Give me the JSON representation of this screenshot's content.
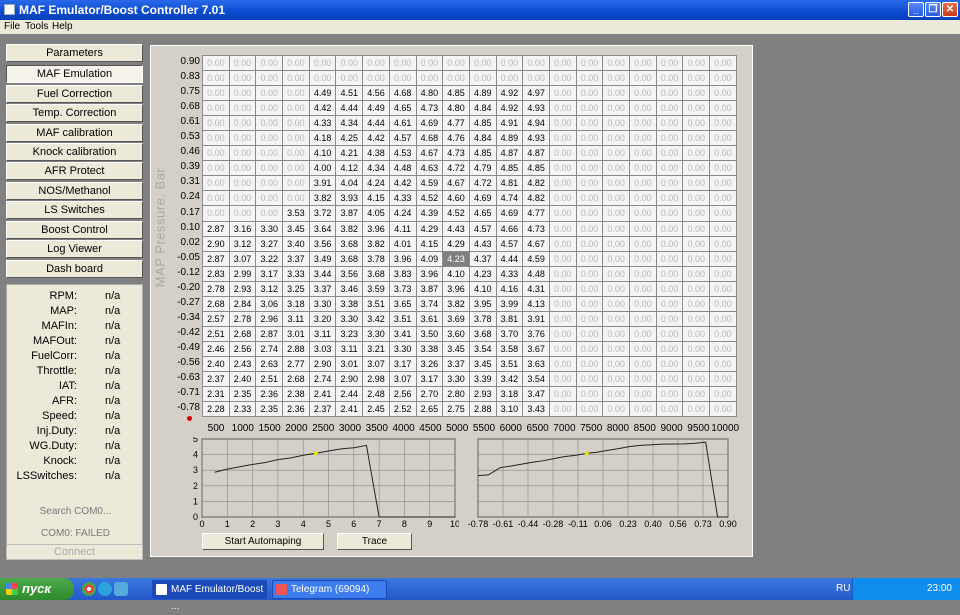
{
  "window": {
    "title": "MAF Emulator/Boost Controller 7.01"
  },
  "menu": [
    "File",
    "Tools",
    "Help"
  ],
  "nav": [
    "Parameters",
    "MAF Emulation",
    "Fuel Correction",
    "Temp. Correction",
    "MAF calibration",
    "Knock calibration",
    "AFR Protect",
    "NOS/Methanol",
    "LS Switches",
    "Boost Control",
    "Log Viewer",
    "Dash board"
  ],
  "status": {
    "rows": [
      [
        "RPM:",
        "n/a"
      ],
      [
        "MAP:",
        "n/a"
      ],
      [
        "MAFIn:",
        "n/a"
      ],
      [
        "MAFOut:",
        "n/a"
      ],
      [
        "FuelCorr:",
        "n/a"
      ],
      [
        "Throttle:",
        "n/a"
      ],
      [
        "IAT:",
        "n/a"
      ],
      [
        "AFR:",
        "n/a"
      ],
      [
        "Speed:",
        "n/a"
      ],
      [
        "Inj.Duty:",
        "n/a"
      ],
      [
        "WG.Duty:",
        "n/a"
      ],
      [
        "Knock:",
        "n/a"
      ],
      [
        "LSSwitches:",
        "n/a"
      ]
    ],
    "search": "Search COM0...",
    "com": "COM0: FAILED",
    "connect": "Connect"
  },
  "table": {
    "y_axis_label": "MAP Pressure, Bar",
    "rows": [
      "0.90",
      "0.83",
      "0.75",
      "0.68",
      "0.61",
      "0.53",
      "0.46",
      "0.39",
      "0.31",
      "0.24",
      "0.17",
      "0.10",
      "0.02",
      "-0.05",
      "-0.12",
      "-0.20",
      "-0.27",
      "-0.34",
      "-0.42",
      "-0.49",
      "-0.56",
      "-0.63",
      "-0.71",
      "-0.78"
    ],
    "cols": [
      "500",
      "1000",
      "1500",
      "2000",
      "2500",
      "3000",
      "3500",
      "4000",
      "4500",
      "5000",
      "5500",
      "6000",
      "6500",
      "7000",
      "7500",
      "8000",
      "8500",
      "9000",
      "9500",
      "10000"
    ],
    "selected": {
      "row": 13,
      "col": 9
    },
    "values": [
      [
        "0.00",
        "0.00",
        "0.00",
        "0.00",
        "0.00",
        "0.00",
        "0.00",
        "0.00",
        "0.00",
        "0.00",
        "0.00",
        "0.00",
        "0.00",
        "0.00",
        "0.00",
        "0.00",
        "0.00",
        "0.00",
        "0.00",
        "0.00"
      ],
      [
        "0.00",
        "0.00",
        "0.00",
        "0.00",
        "0.00",
        "0.00",
        "0.00",
        "0.00",
        "0.00",
        "0.00",
        "0.00",
        "0.00",
        "0.00",
        "0.00",
        "0.00",
        "0.00",
        "0.00",
        "0.00",
        "0.00",
        "0.00"
      ],
      [
        "0.00",
        "0.00",
        "0.00",
        "0.00",
        "4.49",
        "4.51",
        "4.56",
        "4.68",
        "4.80",
        "4.85",
        "4.89",
        "4.92",
        "4.97",
        "0.00",
        "0.00",
        "0.00",
        "0.00",
        "0.00",
        "0.00",
        "0.00"
      ],
      [
        "0.00",
        "0.00",
        "0.00",
        "0.00",
        "4.42",
        "4.44",
        "4.49",
        "4.65",
        "4.73",
        "4.80",
        "4.84",
        "4.92",
        "4.93",
        "0.00",
        "0.00",
        "0.00",
        "0.00",
        "0.00",
        "0.00",
        "0.00"
      ],
      [
        "0.00",
        "0.00",
        "0.00",
        "0.00",
        "4.33",
        "4.34",
        "4.44",
        "4.61",
        "4.69",
        "4.77",
        "4.85",
        "4.91",
        "4.94",
        "0.00",
        "0.00",
        "0.00",
        "0.00",
        "0.00",
        "0.00",
        "0.00"
      ],
      [
        "0.00",
        "0.00",
        "0.00",
        "0.00",
        "4.18",
        "4.25",
        "4.42",
        "4.57",
        "4.68",
        "4.76",
        "4.84",
        "4.89",
        "4.93",
        "0.00",
        "0.00",
        "0.00",
        "0.00",
        "0.00",
        "0.00",
        "0.00"
      ],
      [
        "0.00",
        "0.00",
        "0.00",
        "0.00",
        "4.10",
        "4.21",
        "4.38",
        "4.53",
        "4.67",
        "4.73",
        "4.85",
        "4.87",
        "4.87",
        "0.00",
        "0.00",
        "0.00",
        "0.00",
        "0.00",
        "0.00",
        "0.00"
      ],
      [
        "0.00",
        "0.00",
        "0.00",
        "0.00",
        "4.00",
        "4.12",
        "4.34",
        "4.48",
        "4.63",
        "4.72",
        "4.79",
        "4.85",
        "4.85",
        "0.00",
        "0.00",
        "0.00",
        "0.00",
        "0.00",
        "0.00",
        "0.00"
      ],
      [
        "0.00",
        "0.00",
        "0.00",
        "0.00",
        "3.91",
        "4.04",
        "4.24",
        "4.42",
        "4.59",
        "4.67",
        "4.72",
        "4.81",
        "4.82",
        "0.00",
        "0.00",
        "0.00",
        "0.00",
        "0.00",
        "0.00",
        "0.00"
      ],
      [
        "0.00",
        "0.00",
        "0.00",
        "0.00",
        "3.82",
        "3.93",
        "4.15",
        "4.33",
        "4.52",
        "4.60",
        "4.69",
        "4.74",
        "4.82",
        "0.00",
        "0.00",
        "0.00",
        "0.00",
        "0.00",
        "0.00",
        "0.00"
      ],
      [
        "0.00",
        "0.00",
        "0.00",
        "3.53",
        "3.72",
        "3.87",
        "4.05",
        "4.24",
        "4.39",
        "4.52",
        "4.65",
        "4.69",
        "4.77",
        "0.00",
        "0.00",
        "0.00",
        "0.00",
        "0.00",
        "0.00",
        "0.00"
      ],
      [
        "2.87",
        "3.16",
        "3.30",
        "3.45",
        "3.64",
        "3.82",
        "3.96",
        "4.11",
        "4.29",
        "4.43",
        "4.57",
        "4.66",
        "4.73",
        "0.00",
        "0.00",
        "0.00",
        "0.00",
        "0.00",
        "0.00",
        "0.00"
      ],
      [
        "2.90",
        "3.12",
        "3.27",
        "3.40",
        "3.56",
        "3.68",
        "3.82",
        "4.01",
        "4.15",
        "4.29",
        "4.43",
        "4.57",
        "4.67",
        "0.00",
        "0.00",
        "0.00",
        "0.00",
        "0.00",
        "0.00",
        "0.00"
      ],
      [
        "2.87",
        "3.07",
        "3.22",
        "3.37",
        "3.49",
        "3.68",
        "3.78",
        "3.96",
        "4.09",
        "4.23",
        "4.37",
        "4.44",
        "4.59",
        "0.00",
        "0.00",
        "0.00",
        "0.00",
        "0.00",
        "0.00",
        "0.00"
      ],
      [
        "2.83",
        "2.99",
        "3.17",
        "3.33",
        "3.44",
        "3.56",
        "3.68",
        "3.83",
        "3.96",
        "4.10",
        "4.23",
        "4.33",
        "4.48",
        "0.00",
        "0.00",
        "0.00",
        "0.00",
        "0.00",
        "0.00",
        "0.00"
      ],
      [
        "2.78",
        "2.93",
        "3.12",
        "3.25",
        "3.37",
        "3.46",
        "3.59",
        "3.73",
        "3.87",
        "3.96",
        "4.10",
        "4.16",
        "4.31",
        "0.00",
        "0.00",
        "0.00",
        "0.00",
        "0.00",
        "0.00",
        "0.00"
      ],
      [
        "2.68",
        "2.84",
        "3.06",
        "3.18",
        "3.30",
        "3.38",
        "3.51",
        "3.65",
        "3.74",
        "3.82",
        "3.95",
        "3.99",
        "4.13",
        "0.00",
        "0.00",
        "0.00",
        "0.00",
        "0.00",
        "0.00",
        "0.00"
      ],
      [
        "2.57",
        "2.78",
        "2.96",
        "3.11",
        "3.20",
        "3.30",
        "3.42",
        "3.51",
        "3.61",
        "3.69",
        "3.78",
        "3.81",
        "3.91",
        "0.00",
        "0.00",
        "0.00",
        "0.00",
        "0.00",
        "0.00",
        "0.00"
      ],
      [
        "2.51",
        "2.68",
        "2.87",
        "3.01",
        "3.11",
        "3.23",
        "3.30",
        "3.41",
        "3.50",
        "3.60",
        "3.68",
        "3.70",
        "3.76",
        "0.00",
        "0.00",
        "0.00",
        "0.00",
        "0.00",
        "0.00",
        "0.00"
      ],
      [
        "2.46",
        "2.56",
        "2.74",
        "2.88",
        "3.03",
        "3.11",
        "3.21",
        "3.30",
        "3.38",
        "3.45",
        "3.54",
        "3.58",
        "3.67",
        "0.00",
        "0.00",
        "0.00",
        "0.00",
        "0.00",
        "0.00",
        "0.00"
      ],
      [
        "2.40",
        "2.43",
        "2.63",
        "2.77",
        "2.90",
        "3.01",
        "3.07",
        "3.17",
        "3.26",
        "3.37",
        "3.45",
        "3.51",
        "3.63",
        "0.00",
        "0.00",
        "0.00",
        "0.00",
        "0.00",
        "0.00",
        "0.00"
      ],
      [
        "2.37",
        "2.40",
        "2.51",
        "2.68",
        "2.74",
        "2.90",
        "2.98",
        "3.07",
        "3.17",
        "3.30",
        "3.39",
        "3.42",
        "3.54",
        "0.00",
        "0.00",
        "0.00",
        "0.00",
        "0.00",
        "0.00",
        "0.00"
      ],
      [
        "2.31",
        "2.35",
        "2.36",
        "2.38",
        "2.41",
        "2.44",
        "2.48",
        "2.56",
        "2.70",
        "2.80",
        "2.93",
        "3.18",
        "3.47",
        "0.00",
        "0.00",
        "0.00",
        "0.00",
        "0.00",
        "0.00",
        "0.00"
      ],
      [
        "2.28",
        "2.33",
        "2.35",
        "2.36",
        "2.37",
        "2.41",
        "2.45",
        "2.52",
        "2.65",
        "2.75",
        "2.88",
        "3.10",
        "3.43",
        "0.00",
        "0.00",
        "0.00",
        "0.00",
        "0.00",
        "0.00",
        "0.00"
      ]
    ]
  },
  "chart_data": [
    {
      "type": "line",
      "x": [
        0.5,
        1,
        1.5,
        2,
        2.5,
        3,
        3.5,
        4,
        4.5,
        5,
        5.5,
        6,
        6.5,
        7,
        10
      ],
      "values": [
        2.87,
        3.07,
        3.22,
        3.37,
        3.49,
        3.68,
        3.78,
        3.96,
        4.09,
        4.23,
        4.37,
        4.44,
        4.59,
        0,
        0
      ],
      "xticks": [
        "0",
        "1",
        "2",
        "3",
        "4",
        "5",
        "6",
        "7",
        "8",
        "9",
        "10"
      ],
      "yticks": [
        "0",
        "1",
        "2",
        "3",
        "4",
        "5"
      ],
      "xlim": [
        0,
        10
      ],
      "ylim": [
        0,
        5
      ],
      "marker": {
        "x": 4.5,
        "y": 4.09
      }
    },
    {
      "type": "line",
      "x": [
        -0.78,
        -0.71,
        -0.63,
        -0.56,
        -0.49,
        -0.42,
        -0.34,
        -0.27,
        -0.2,
        -0.12,
        -0.05,
        0.02,
        0.1,
        0.17,
        0.24,
        0.31,
        0.39,
        0.46,
        0.53,
        0.61,
        0.68,
        0.75,
        0.83,
        0.9
      ],
      "values": [
        2.65,
        2.7,
        3.17,
        3.26,
        3.38,
        3.5,
        3.61,
        3.74,
        3.87,
        3.96,
        4.09,
        4.15,
        4.29,
        4.39,
        4.52,
        4.59,
        4.63,
        4.67,
        4.68,
        4.69,
        4.73,
        4.8,
        0,
        0
      ],
      "xticks": [
        "-0.78",
        "-0.61",
        "-0.44",
        "-0.28",
        "-0.11",
        "0.06",
        "0.23",
        "0.40",
        "0.56",
        "0.73",
        "0.90"
      ],
      "xlim": [
        -0.78,
        0.9
      ],
      "ylim": [
        0,
        5
      ],
      "marker": {
        "x": -0.05,
        "y": 4.09
      }
    }
  ],
  "buttons": {
    "automap": "Start Automaping",
    "trace": "Trace"
  },
  "taskbar": {
    "start": "пуск",
    "tasks": [
      "MAF Emulator/Boost ...",
      "Telegram (69094)"
    ],
    "lang": "RU",
    "clock": "23:00"
  },
  "colors": {
    "title_bar": "#0a4ad0",
    "panel": "#d4d0c8",
    "marker": "#e8e800",
    "selected_cell": "#7f7f7f"
  }
}
